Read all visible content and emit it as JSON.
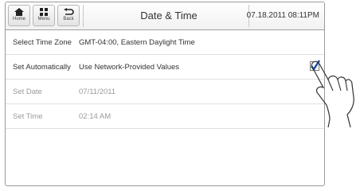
{
  "header": {
    "home_label": "Home",
    "menu_label": "Menu",
    "back_label": "Back",
    "title": "Date & Time",
    "datetime": "07.18.2011 08:11PM"
  },
  "settings": [
    {
      "label": "Select Time Zone",
      "value": "GMT-04:00, Eastern Daylight Time",
      "enabled": true
    },
    {
      "label": "Set Automatically",
      "value": "Use Network-Provided Values",
      "enabled": true,
      "checked": true
    },
    {
      "label": "Set Date",
      "value": "07/11/2011",
      "enabled": false
    },
    {
      "label": "Set Time",
      "value": "02:14 AM",
      "enabled": false
    }
  ],
  "colors": {
    "checkmark": "#1f4f9e"
  }
}
